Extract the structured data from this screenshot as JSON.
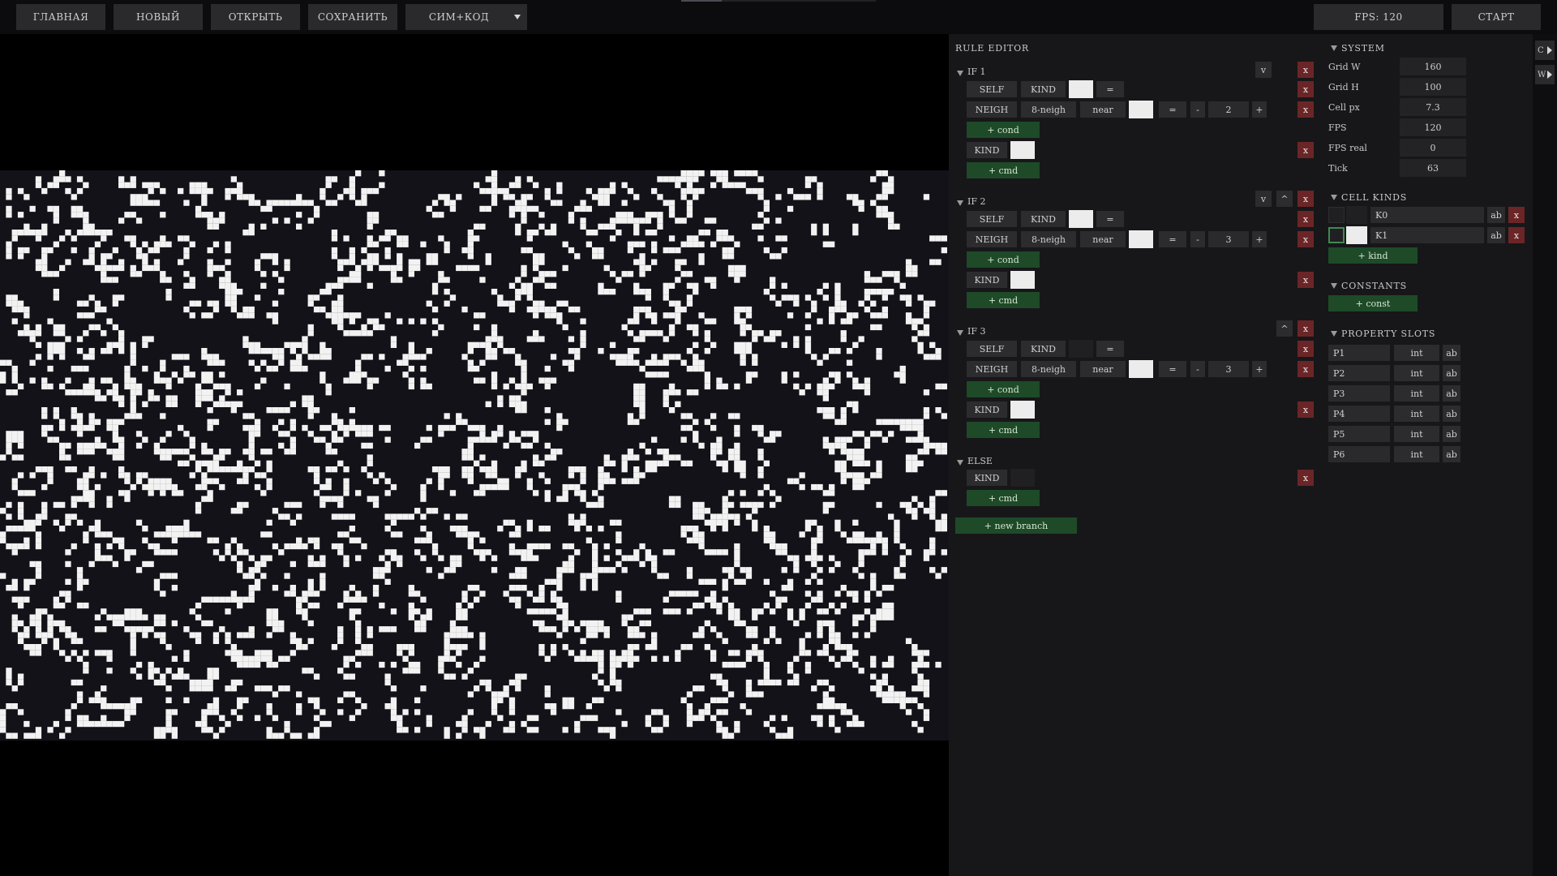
{
  "toolbar": {
    "home": "ГЛАВНАЯ",
    "new": "НОВЫЙ",
    "open": "ОТКРЫТЬ",
    "save": "СОХРАНИТЬ",
    "mode": "СИМ+КОД",
    "fps": "FPS: 120",
    "start": "СТАРТ"
  },
  "editor": {
    "title": "RULE EDITOR",
    "branches": [
      {
        "label": "IF 1",
        "controls": [
          "v"
        ],
        "conditions": [
          {
            "subject": "SELF",
            "prop": "KIND",
            "color": "light",
            "op": "="
          },
          {
            "subject": "NEIGH",
            "scope": "8-neigh",
            "mode": "near",
            "color": "light",
            "op": "=",
            "minus": "-",
            "value": "2",
            "plus": "+"
          }
        ],
        "add_cond": "+ cond",
        "command": {
          "prop": "KIND",
          "color": "light"
        },
        "add_cmd": "+ cmd"
      },
      {
        "label": "IF 2",
        "controls": [
          "v",
          "^"
        ],
        "conditions": [
          {
            "subject": "SELF",
            "prop": "KIND",
            "color": "light",
            "op": "="
          },
          {
            "subject": "NEIGH",
            "scope": "8-neigh",
            "mode": "near",
            "color": "light",
            "op": "=",
            "minus": "-",
            "value": "3",
            "plus": "+"
          }
        ],
        "add_cond": "+ cond",
        "command": {
          "prop": "KIND",
          "color": "light"
        },
        "add_cmd": "+ cmd"
      },
      {
        "label": "IF 3",
        "controls": [
          "^"
        ],
        "conditions": [
          {
            "subject": "SELF",
            "prop": "KIND",
            "color": "dark",
            "op": "="
          },
          {
            "subject": "NEIGH",
            "scope": "8-neigh",
            "mode": "near",
            "color": "light",
            "op": "=",
            "minus": "-",
            "value": "3",
            "plus": "+"
          }
        ],
        "add_cond": "+ cond",
        "command": {
          "prop": "KIND",
          "color": "light"
        },
        "add_cmd": "+ cmd"
      }
    ],
    "else": {
      "label": "ELSE",
      "command": {
        "prop": "KIND",
        "color": "dark"
      },
      "add_cmd": "+ cmd"
    },
    "delete": "x",
    "new_branch": "+ new branch"
  },
  "system": {
    "title": "SYSTEM",
    "rows": [
      {
        "label": "Grid W",
        "value": "160"
      },
      {
        "label": "Grid H",
        "value": "100"
      },
      {
        "label": "Cell px",
        "value": "7.3"
      },
      {
        "label": "FPS",
        "value": "120"
      },
      {
        "label": "FPS real",
        "value": "0"
      },
      {
        "label": "Tick",
        "value": "63"
      }
    ]
  },
  "cell_kinds": {
    "title": "CELL KINDS",
    "kinds": [
      {
        "name": "K0",
        "color": "dark",
        "rename": "ab",
        "delete": "x",
        "selected": false
      },
      {
        "name": "K1",
        "color": "light",
        "rename": "ab",
        "delete": "x",
        "selected": true
      }
    ],
    "add": "+ kind"
  },
  "constants": {
    "title": "CONSTANTS",
    "add": "+ const"
  },
  "property_slots": {
    "title": "PROPERTY SLOTS",
    "slots": [
      {
        "name": "P1",
        "type": "int",
        "rename": "ab"
      },
      {
        "name": "P2",
        "type": "int",
        "rename": "ab"
      },
      {
        "name": "P3",
        "type": "int",
        "rename": "ab"
      },
      {
        "name": "P4",
        "type": "int",
        "rename": "ab"
      },
      {
        "name": "P5",
        "type": "int",
        "rename": "ab"
      },
      {
        "name": "P6",
        "type": "int",
        "rename": "ab"
      }
    ]
  },
  "side_tabs": [
    "C",
    "W"
  ],
  "colors": {
    "light": "#ececec",
    "dark": "#202023",
    "cell": "#f2f2f2",
    "grid_bg": "#121218",
    "danger": "#6b2526",
    "add": "#1e4a28"
  }
}
